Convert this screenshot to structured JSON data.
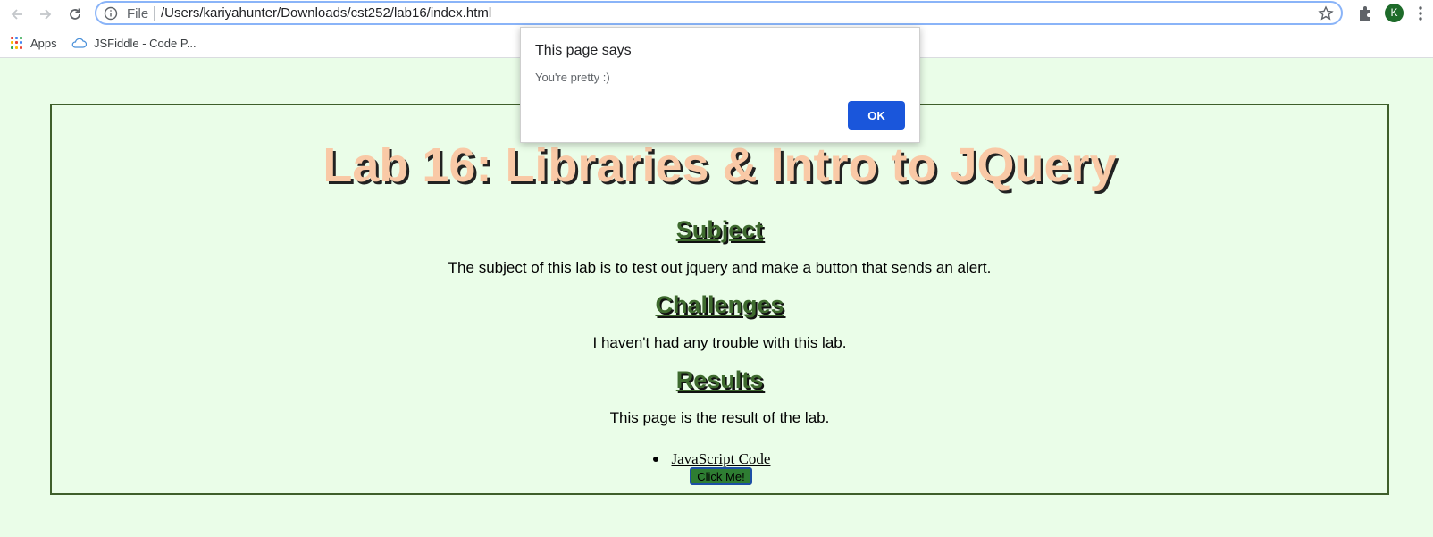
{
  "browser": {
    "omnibox": {
      "scheme_label": "File",
      "url": "/Users/kariyahunter/Downloads/cst252/lab16/index.html"
    },
    "profile_initial": "K",
    "bookmarks": [
      {
        "label": "Apps",
        "icon": "apps-grid-icon"
      },
      {
        "label": "JSFiddle - Code P...",
        "icon": "jsfiddle-cloud-icon"
      }
    ]
  },
  "page": {
    "title": "Lab 16: Libraries & Intro to JQuery",
    "sections": [
      {
        "heading": "Subject",
        "text": "The subject of this lab is to test out jquery and make a button that sends an alert."
      },
      {
        "heading": "Challenges",
        "text": "I haven't had any trouble with this lab."
      },
      {
        "heading": "Results",
        "text": "This page is the result of the lab."
      }
    ],
    "link_label": "JavaScript Code",
    "button_label": "Click Me!"
  },
  "dialog": {
    "title": "This page says",
    "message": "You're pretty :)",
    "ok_label": "OK"
  },
  "colors": {
    "page_bg": "#eafde8",
    "title": "#f9c9a6",
    "headings": "#3e6a2e",
    "border": "#3f5f2b",
    "dialog_button": "#1a56db"
  }
}
